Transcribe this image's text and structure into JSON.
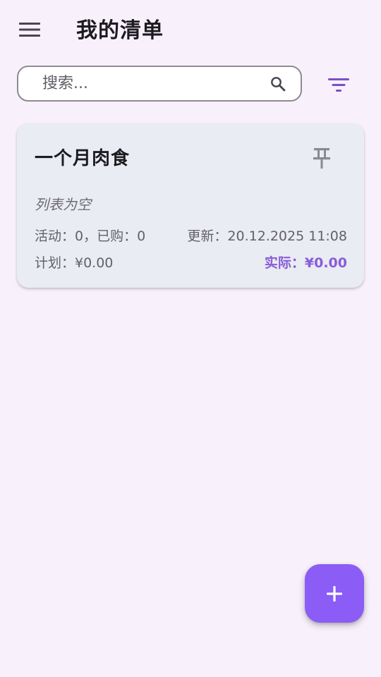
{
  "app_bar": {
    "menu_icon": "menu-icon",
    "title": "我的清单"
  },
  "search": {
    "placeholder": "搜索...",
    "value": "",
    "search_icon": "search-icon",
    "filter_icon": "filter-icon"
  },
  "lists": [
    {
      "title": "一个月肉食",
      "pin_icon": "pin-icon",
      "empty_text": "列表为空",
      "stats_text": "活动：0，已购：0",
      "updated_text": "更新：20.12.2025 11:08",
      "planned_text": "计划：¥0.00",
      "actual_text": "实际：¥0.00"
    }
  ],
  "fab": {
    "icon": "add-icon"
  },
  "colors": {
    "background": "#F8F1FC",
    "card": "#E9ECF2",
    "accent": "#8B5CF6",
    "actual_text": "#8A5CD8",
    "filter_icon": "#7B4FC7"
  }
}
